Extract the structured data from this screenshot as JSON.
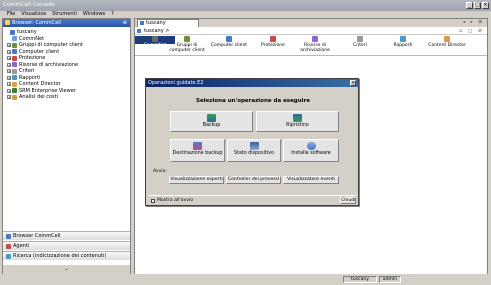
{
  "window": {
    "title": "CommCell Console"
  },
  "menu": [
    "File",
    "Visualizza",
    "Strumenti",
    "Windows",
    "?"
  ],
  "browser": {
    "header": "Browser: CommCell",
    "tree": [
      {
        "label": "tuscany",
        "level": 0,
        "color": "#4a78c8",
        "expander": ""
      },
      {
        "label": "CommNet",
        "level": 1,
        "color": "#6fa0d8",
        "expander": ""
      },
      {
        "label": "Gruppi di computer client",
        "level": 1,
        "color": "#6f8f3a",
        "expander": "+"
      },
      {
        "label": "Computer client",
        "level": 1,
        "color": "#4a78c8",
        "expander": "+"
      },
      {
        "label": "Protezione",
        "level": 1,
        "color": "#c84a4a",
        "expander": "+"
      },
      {
        "label": "Risorse di archiviazione",
        "level": 1,
        "color": "#8a6ac8",
        "expander": "+"
      },
      {
        "label": "Criteri",
        "level": 1,
        "color": "#9a9a9a",
        "expander": "+"
      },
      {
        "label": "Rapporti",
        "level": 1,
        "color": "#4a9ac8",
        "expander": "+"
      },
      {
        "label": "Content Director",
        "level": 1,
        "color": "#d8a040",
        "expander": "+"
      },
      {
        "label": "SRM Enterprise Viewer",
        "level": 1,
        "color": "#3a7a3a",
        "expander": "+"
      },
      {
        "label": "Analisi dei costi",
        "level": 1,
        "color": "#c8a040",
        "expander": "+"
      }
    ],
    "nav": [
      {
        "label": "Browser CommCell",
        "color": "#4a78c8"
      },
      {
        "label": "Agenti",
        "color": "#c84a4a"
      },
      {
        "label": "Ricerca (indicizzazione dei contenuti)",
        "color": "#4a9ac8"
      }
    ]
  },
  "main": {
    "tab": "tuscany",
    "tab_ctrls": "◂ ▸ ⊠",
    "crumb": "tuscany  >",
    "crumb_ctrls": "▫ ◻ ⊘",
    "toolbar": [
      {
        "label": "CommNet",
        "color": "#6a6a6a",
        "selected": true
      },
      {
        "label": "Gruppi di computer client",
        "color": "#6f8f3a"
      },
      {
        "label": "Computer client",
        "color": "#4a78c8"
      },
      {
        "label": "Protezione",
        "color": "#c84a4a"
      },
      {
        "label": "Risorse di archiviazione",
        "color": "#8a6ac8"
      },
      {
        "label": "Criteri",
        "color": "#9a9a9a"
      },
      {
        "label": "Rapporti",
        "color": "#4a9ac8"
      },
      {
        "label": "Content Director",
        "color": "#d8a040"
      }
    ]
  },
  "dialog": {
    "title": "Operazioni guidate E2",
    "heading": "Seleziona un'operazione da eseguire",
    "backup": "Backup",
    "restore": "Ripristino",
    "dest_backup": "Destinazione backup",
    "device_state": "Stato dispositivo",
    "install_sw": "Installa software",
    "avvia": "Avvia:",
    "expert_view": "Visualizzazione esperti",
    "process_ctrl": "Controller dei processi",
    "event_viewer": "Visualizzatore eventi",
    "show_at_start": "Mostra all'avvio",
    "close": "Chiudi"
  },
  "status": {
    "host": "tuscany",
    "user": "admin"
  }
}
